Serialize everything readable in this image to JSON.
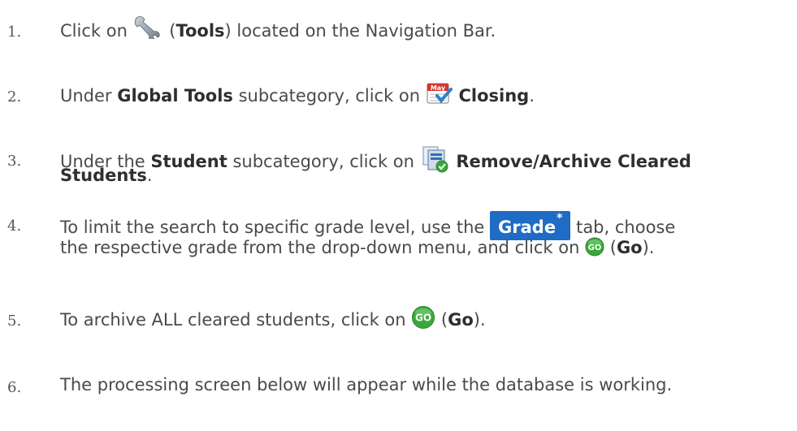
{
  "steps": [
    {
      "num": "1.",
      "pre": "Click on ",
      "icon": "wrench-icon",
      "mid": " (",
      "bold": "Tools",
      "post": ") located on the Navigation Bar."
    },
    {
      "num": "2.",
      "pre": "Under ",
      "bold1": "Global Tools",
      "mid": " subcategory, click on ",
      "icon": "calendar-icon",
      "icon_text": "May",
      "bold2": "Closing",
      "post": "."
    },
    {
      "num": "3.",
      "pre": "Under the ",
      "bold1": "Student",
      "mid": " subcategory, click on ",
      "icon": "archive-check-icon",
      "bold2": "Remove/Archive Cleared",
      "bold3": "Students",
      "post": "."
    },
    {
      "num": "4.",
      "pre": "To limit the search to specific grade level, use the ",
      "tab_label": "Grade",
      "tab_mark": "*",
      "mid": " tab, choose",
      "line2_pre": "the respective grade from the drop-down menu, and click on ",
      "icon": "go-icon",
      "icon_text": "GO",
      "line2_mid": " (",
      "bold": "Go",
      "post": ")."
    },
    {
      "num": "5.",
      "pre": "To archive ALL cleared students, click on ",
      "icon": "go-icon",
      "icon_text": "GO",
      "mid": " (",
      "bold": "Go",
      "post": ")."
    },
    {
      "num": "6.",
      "text": "The processing screen below will appear while the database is working."
    }
  ],
  "colors": {
    "text": "#4a4a4a",
    "tab": "#1e6cc4",
    "go": "#3aa93a"
  }
}
